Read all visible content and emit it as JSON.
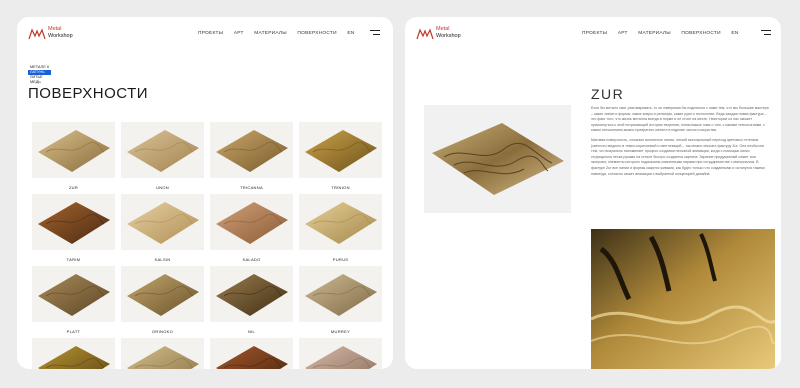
{
  "brand": {
    "line1": "Metal",
    "line2": "Workshop",
    "accent": "#c0392b"
  },
  "nav": [
    "ПРОЕКТЫ",
    "АРТ",
    "МАТЕРИАЛЫ",
    "ПОВЕРХНОСТИ",
    "EN"
  ],
  "left": {
    "filter": [
      "МЕТАЛЛ ∨",
      "ЛАТУНЬ",
      "ЛИТЬЕ",
      "МЕДЬ"
    ],
    "title": "ПОВЕРХНОСТИ",
    "tiles": [
      {
        "label": "ZUR"
      },
      {
        "label": "UNON"
      },
      {
        "label": "TRICANNA"
      },
      {
        "label": "TRINION"
      },
      {
        "label": "TARIM"
      },
      {
        "label": "SALSIN"
      },
      {
        "label": "SALADO"
      },
      {
        "label": "PURUS"
      },
      {
        "label": "PLATT"
      },
      {
        "label": "ORINOKO"
      },
      {
        "label": "NIL"
      },
      {
        "label": "MURREY"
      },
      {
        "label": ""
      },
      {
        "label": ""
      },
      {
        "label": ""
      },
      {
        "label": ""
      }
    ]
  },
  "right": {
    "title": "ZUR",
    "para1": "Если бы металл смог разговаривать, то он наверняка бы поделился с нами тем, что мы большие мастера – какие линии и формы, какие ковры и рельефы, какие руки и технологии. Ведь каждая новая фактура – это факт того, что жизнь металла всегда в норме и не стоит на месте. Некоторые из нас сможет прикоснуться к этой потрясающей истории творения, понаслышке зная о том, с какими технологиями, с каким отношением можно превратить металл в изделие чистого искусства.",
    "para2": "Матовая поверхность, сложные волнистые линии, легкий монохромный переход цветовых оттенков (светлого медного в темно-коричневый и светлеющий – так можно описать фактуру Zur. Она необычна тем, что визуально напоминает процесс создания песчаной анимации, когда с помощью мягко струящегося песка руками на стекле быстро создается картина. Зарание придуманный сюжет или экспромт, элементы которого подсказаны комнатными парами при сотрудничестве с материалом. В фактуре Zur все линии и формы кажутся живыми, как будто только что созданными и останутся такими навсегда, согласно сюжет анимации с выбранной концепцией дизайна."
  }
}
